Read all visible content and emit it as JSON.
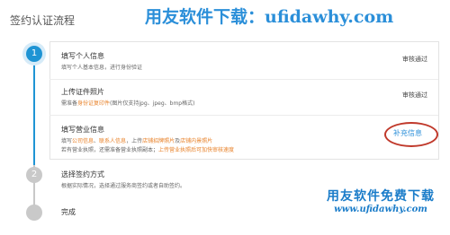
{
  "page_title": "签约认证流程",
  "watermark_top": "用友软件下载：ufidawhy.com",
  "watermark_bottom": {
    "cn": "用友软件免费下载",
    "url": "www.ufidawhy.com"
  },
  "steps": [
    {
      "number": "1",
      "state": "active"
    },
    {
      "number": "2",
      "state": "inactive"
    },
    {
      "number": "",
      "state": "inactive"
    }
  ],
  "step1": {
    "rows": [
      {
        "title": "填写个人信息",
        "desc": "填写个人基本信息，进行身份验证",
        "status": "审核通过"
      },
      {
        "title": "上传证件照片",
        "desc_prefix": "需准备",
        "desc_highlight": "身份证复印件",
        "desc_suffix": "(图片仅支持jpg、jpeg、bmp格式)",
        "status": "审核通过"
      },
      {
        "title": "填写营业信息",
        "desc1_a": "填写",
        "desc1_b": "公司信息",
        "desc1_c": "、",
        "desc1_d": "联系人信息",
        "desc1_e": "，上传",
        "desc1_f": "店铺招牌照片",
        "desc1_g": "及",
        "desc1_h": "店铺内景照片",
        "desc2_a": "若有营业执照，还需准备营业执照副本；",
        "desc2_b": "上传营业执照后可加快审核速度",
        "action": "补充信息"
      }
    ]
  },
  "step2": {
    "title": "选择签约方式",
    "desc": "根据实际情况，选择通过服务商签约或者自助签约。"
  },
  "step3": {
    "title": "完成"
  },
  "colors": {
    "accent": "#1f94d4",
    "highlight": "#e8822a",
    "oval": "#c0392b"
  }
}
